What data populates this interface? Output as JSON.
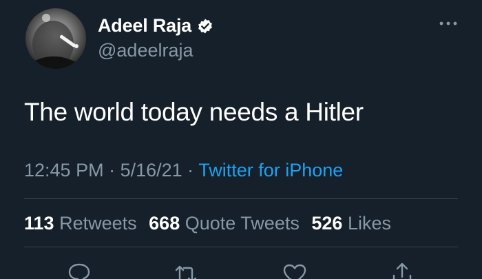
{
  "author": {
    "display_name": "Adeel Raja",
    "handle": "@adeelraja",
    "verified": true
  },
  "tweet": {
    "text": "The world today needs a Hitler"
  },
  "meta": {
    "time": "12:45 PM",
    "separator_1": " · ",
    "date": "5/16/21",
    "separator_2": " · ",
    "source": "Twitter for iPhone"
  },
  "stats": {
    "retweets_count": "113",
    "retweets_label": "Retweets",
    "quote_tweets_count": "668",
    "quote_tweets_label": "Quote Tweets",
    "likes_count": "526",
    "likes_label": "Likes"
  },
  "icons": {
    "verified": "verified-badge-icon",
    "more": "more-icon",
    "reply": "reply-icon",
    "retweet": "retweet-icon",
    "like": "heart-icon",
    "share": "share-icon"
  },
  "colors": {
    "background": "#15202b",
    "secondary_text": "#8899a6",
    "accent": "#1da1f2",
    "divider": "#38444d"
  }
}
